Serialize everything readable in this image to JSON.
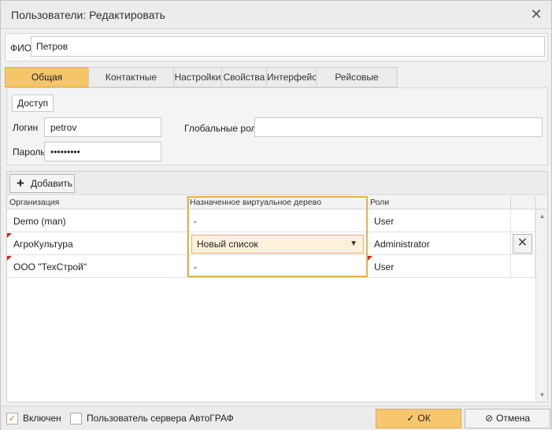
{
  "window": {
    "title": "Пользователи: Редактировать",
    "close_icon": "close-icon"
  },
  "fio": {
    "label": "ФИО",
    "value": "Петров"
  },
  "tabs": [
    {
      "label": "Общая информация",
      "active": true
    },
    {
      "label": "Контактные данные",
      "active": false
    },
    {
      "label": "Настройки",
      "active": false
    },
    {
      "label": "Свойства",
      "active": false
    },
    {
      "label": "Интерфейс",
      "active": false
    },
    {
      "label": "Рейсовые периоды",
      "active": false
    }
  ],
  "access": {
    "legend": "Доступ",
    "login_label": "Логин",
    "login_value": "petrov",
    "password_label": "Пароль",
    "password_value": "•••••••••",
    "global_roles_label": "Глобальные роли",
    "global_roles_value": ""
  },
  "grid": {
    "add_label": "Добавить",
    "columns": [
      "Организация",
      "Назначенное виртуальное дерево",
      "Роли"
    ],
    "rows": [
      {
        "org": "Demo (man)",
        "tree": "-",
        "role": "User"
      },
      {
        "org": "АгроКультура",
        "tree": "Новый список",
        "role": "Administrator"
      },
      {
        "org": "ООО \"ТехСтрой\"",
        "tree": "-",
        "role": "User"
      }
    ]
  },
  "footer": {
    "enabled_label": "Включен",
    "enabled_checked": true,
    "server_user_label": "Пользователь сервера АвтоГРАФ",
    "server_user_checked": false,
    "ok_label": "ОК",
    "cancel_label": "Отмена"
  },
  "colors": {
    "accent": "#f5c56a",
    "accent_border": "#e0b44a",
    "dirty_marker": "#e02020"
  }
}
